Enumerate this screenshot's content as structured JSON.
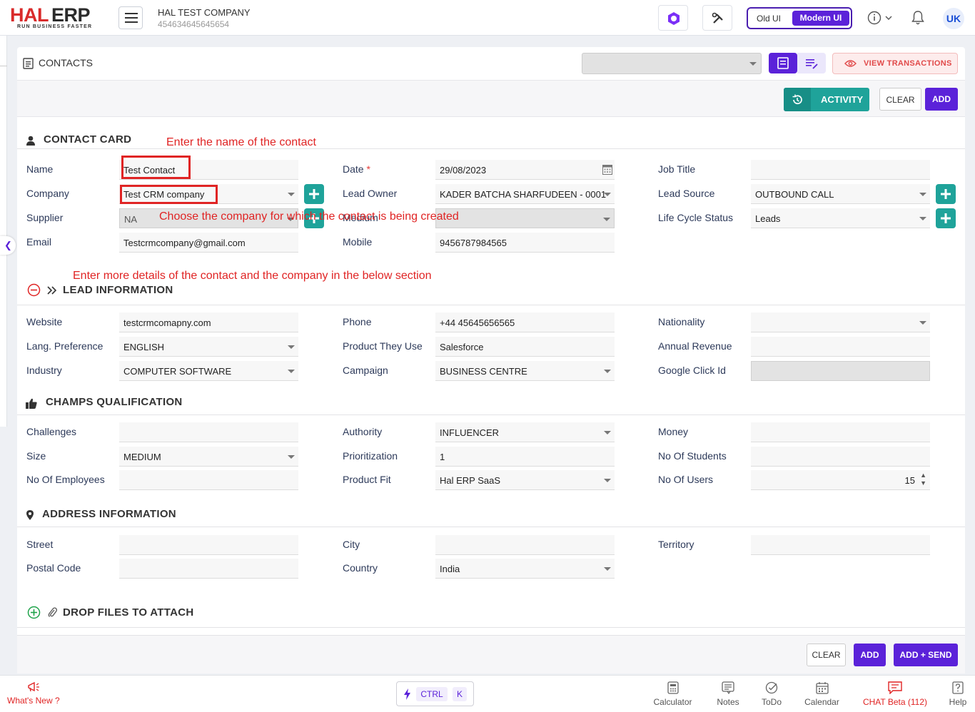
{
  "header": {
    "logo_primary": "HAL",
    "logo_secondary": "ERP",
    "logo_tagline": "RUN BUSINESS FASTER",
    "company_name": "HAL TEST COMPANY",
    "company_id": "454634645645654",
    "ui_old": "Old UI",
    "ui_modern": "Modern UI",
    "avatar_initials": "UK"
  },
  "page": {
    "title": "CONTACTS",
    "view_transactions": "VIEW TRANSACTIONS",
    "activity": "ACTIVITY",
    "clear": "CLEAR",
    "add": "ADD"
  },
  "sections": {
    "contact_card": "CONTACT CARD",
    "lead_information": "LEAD INFORMATION",
    "champs": "CHAMPS QUALIFICATION",
    "address": "ADDRESS INFORMATION",
    "attach": "DROP FILES TO ATTACH"
  },
  "contact_card": {
    "name_label": "Name",
    "name_value": "Test Contact",
    "company_label": "Company",
    "company_value": "Test CRM company",
    "supplier_label": "Supplier",
    "supplier_value": "NA",
    "email_label": "Email",
    "email_value": "Testcrmcompany@gmail.com",
    "date_label": "Date",
    "date_value": "29/08/2023",
    "lead_owner_label": "Lead Owner",
    "lead_owner_value": "KADER BATCHA  SHARFUDEEN - 0001",
    "medium_label": "Medium",
    "medium_value": "",
    "mobile_label": "Mobile",
    "mobile_value": "9456787984565",
    "job_title_label": "Job Title",
    "job_title_value": "",
    "lead_source_label": "Lead Source",
    "lead_source_value": "OUTBOUND CALL",
    "lifecycle_label": "Life Cycle Status",
    "lifecycle_value": "Leads"
  },
  "lead_info": {
    "website_label": "Website",
    "website_value": "testcrmcomapny.com",
    "lang_label": "Lang. Preference",
    "lang_value": "ENGLISH",
    "industry_label": "Industry",
    "industry_value": "COMPUTER SOFTWARE",
    "phone_label": "Phone",
    "phone_value": "+44 45645656565",
    "product_label": "Product They Use",
    "product_value": "Salesforce",
    "campaign_label": "Campaign",
    "campaign_value": "BUSINESS CENTRE",
    "nationality_label": "Nationality",
    "nationality_value": "",
    "revenue_label": "Annual Revenue",
    "revenue_value": "",
    "gclid_label": "Google Click Id",
    "gclid_value": ""
  },
  "champs": {
    "challenges_label": "Challenges",
    "challenges_value": "",
    "size_label": "Size",
    "size_value": "MEDIUM",
    "employees_label": "No Of Employees",
    "employees_value": "",
    "authority_label": "Authority",
    "authority_value": "INFLUENCER",
    "prioritization_label": "Prioritization",
    "prioritization_value": "1",
    "productfit_label": "Product Fit",
    "productfit_value": "Hal ERP SaaS",
    "money_label": "Money",
    "money_value": "",
    "students_label": "No Of Students",
    "students_value": "",
    "users_label": "No Of Users",
    "users_value": "15"
  },
  "address": {
    "street_label": "Street",
    "street_value": "",
    "postal_label": "Postal Code",
    "postal_value": "",
    "city_label": "City",
    "city_value": "",
    "country_label": "Country",
    "country_value": "India",
    "territory_label": "Territory",
    "territory_value": ""
  },
  "annotations": {
    "a1": "Enter the name of the contact",
    "a2": "Choose the company for which the contact is being created",
    "a3": "Enter more details of the contact and the company in the below section"
  },
  "footer_buttons": {
    "clear": "CLEAR",
    "add": "ADD",
    "add_send": "ADD + SEND"
  },
  "bottombar": {
    "whats_new": "What's New ?",
    "ctrl": "CTRL",
    "k": "K",
    "calculator": "Calculator",
    "notes": "Notes",
    "todo": "ToDo",
    "calendar": "Calendar",
    "chat": "CHAT Beta (112)",
    "help": "Help"
  },
  "colors": {
    "brand_red": "#d92b2b",
    "accent_purple": "#5b22d9",
    "teal": "#1fa39a",
    "annotation_red": "#e02424"
  }
}
